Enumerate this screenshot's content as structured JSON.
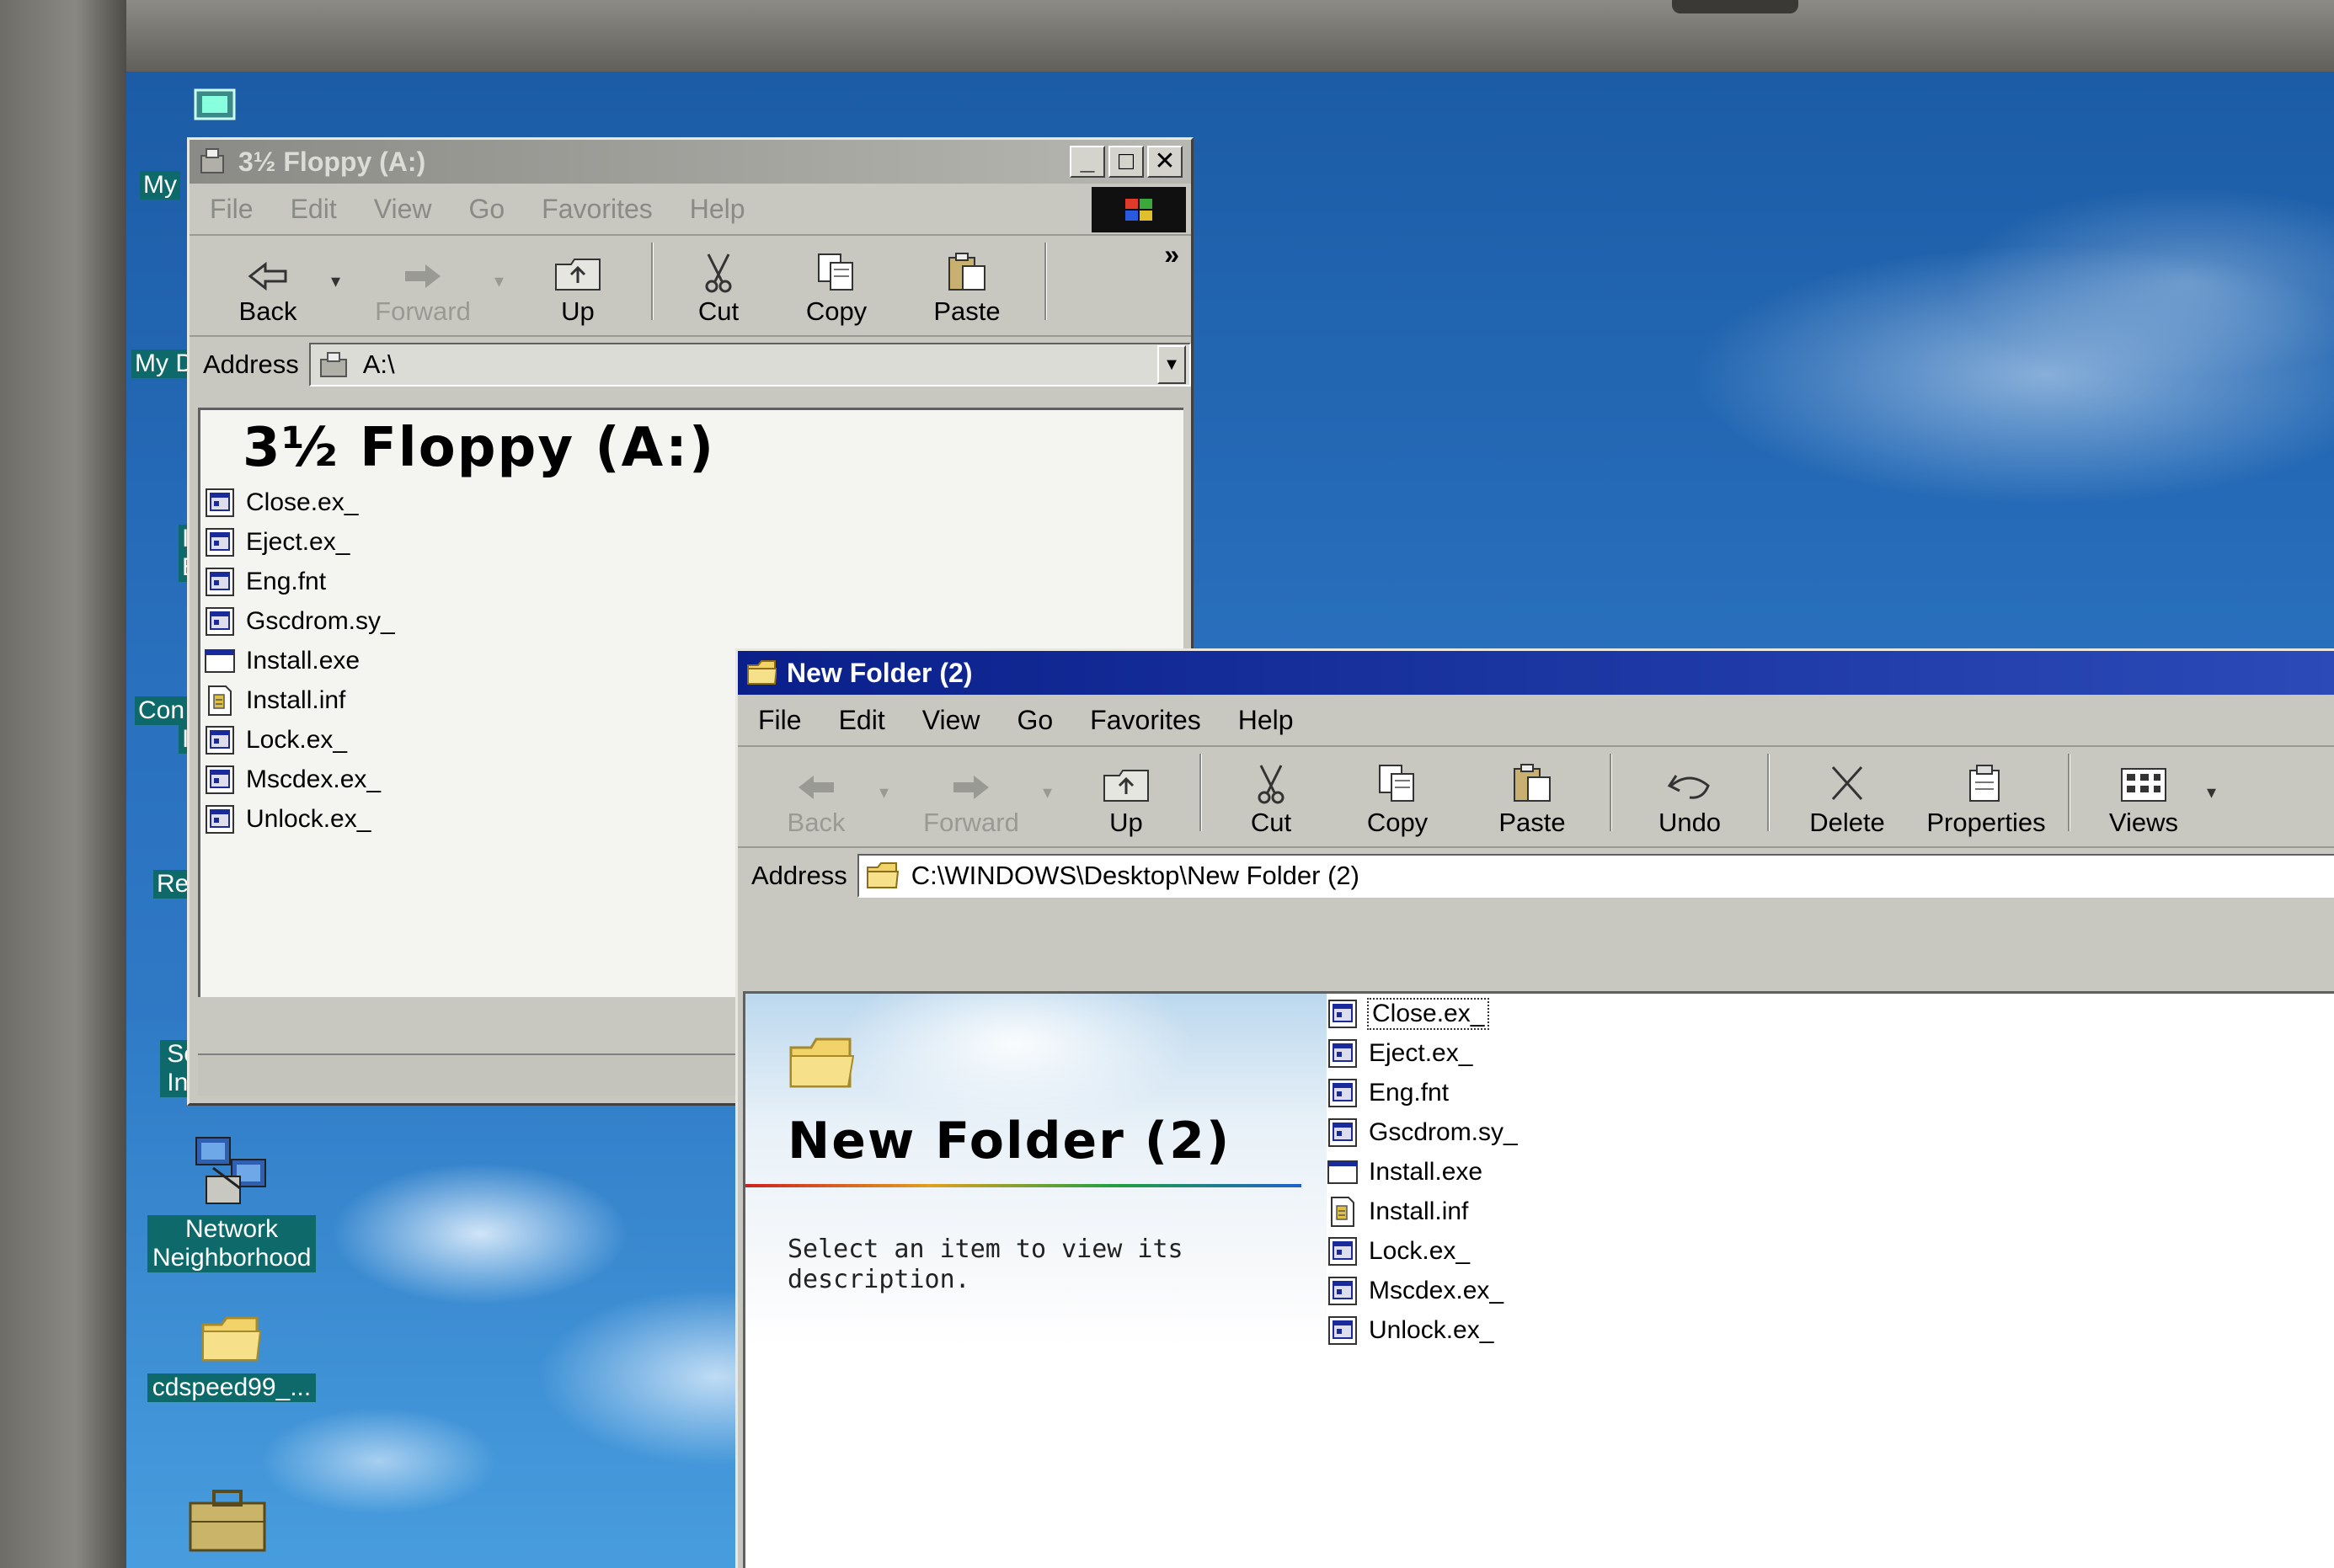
{
  "desktop": {
    "left_labels": [
      "My",
      "My D",
      "I",
      "E",
      "Con",
      "I",
      "Re"
    ],
    "icons": [
      {
        "label": "Setup MSN Internet A..."
      },
      {
        "label": "Network Neighborhood"
      },
      {
        "label": "cdspeed99_..."
      }
    ]
  },
  "floppy_window": {
    "title": "3½ Floppy (A:)",
    "menu": [
      "File",
      "Edit",
      "View",
      "Go",
      "Favorites",
      "Help"
    ],
    "toolbar": {
      "back": "Back",
      "forward": "Forward",
      "up": "Up",
      "cut": "Cut",
      "copy": "Copy",
      "paste": "Paste",
      "more": "»"
    },
    "address_label": "Address",
    "address_value": "A:\\",
    "heading": "3½ Floppy (A:)",
    "files": [
      {
        "name": "Close.ex_",
        "icon": "app-file-icon"
      },
      {
        "name": "Eject.ex_",
        "icon": "app-file-icon"
      },
      {
        "name": "Eng.fnt",
        "icon": "app-file-icon"
      },
      {
        "name": "Gscdrom.sy_",
        "icon": "app-file-icon"
      },
      {
        "name": "Install.exe",
        "icon": "exe-window-icon"
      },
      {
        "name": "Install.inf",
        "icon": "inf-file-icon"
      },
      {
        "name": "Lock.ex_",
        "icon": "app-file-icon"
      },
      {
        "name": "Mscdex.ex_",
        "icon": "app-file-icon"
      },
      {
        "name": "Unlock.ex_",
        "icon": "app-file-icon"
      }
    ]
  },
  "newfolder_window": {
    "title": "New Folder (2)",
    "menu": [
      "File",
      "Edit",
      "View",
      "Go",
      "Favorites",
      "Help"
    ],
    "toolbar": {
      "back": "Back",
      "forward": "Forward",
      "up": "Up",
      "cut": "Cut",
      "copy": "Copy",
      "paste": "Paste",
      "undo": "Undo",
      "delete": "Delete",
      "properties": "Properties",
      "views": "Views"
    },
    "address_label": "Address",
    "address_value": "C:\\WINDOWS\\Desktop\\New Folder (2)",
    "heading": "New Folder (2)",
    "description": "Select an item to view its description.",
    "files": [
      {
        "name": "Close.ex_",
        "icon": "app-file-icon",
        "selected": true
      },
      {
        "name": "Eject.ex_",
        "icon": "app-file-icon"
      },
      {
        "name": "Eng.fnt",
        "icon": "app-file-icon"
      },
      {
        "name": "Gscdrom.sy_",
        "icon": "app-file-icon"
      },
      {
        "name": "Install.exe",
        "icon": "exe-window-icon"
      },
      {
        "name": "Install.inf",
        "icon": "inf-file-icon"
      },
      {
        "name": "Lock.ex_",
        "icon": "app-file-icon"
      },
      {
        "name": "Mscdex.ex_",
        "icon": "app-file-icon"
      },
      {
        "name": "Unlock.ex_",
        "icon": "app-file-icon"
      }
    ]
  },
  "colors": {
    "desktop_blue": "#2a72c0",
    "active_title": "#0a1f8a",
    "inactive_title": "#8a8a86",
    "window_face": "#c8c8c0",
    "icon_label_bg": "#0e6a6a"
  }
}
